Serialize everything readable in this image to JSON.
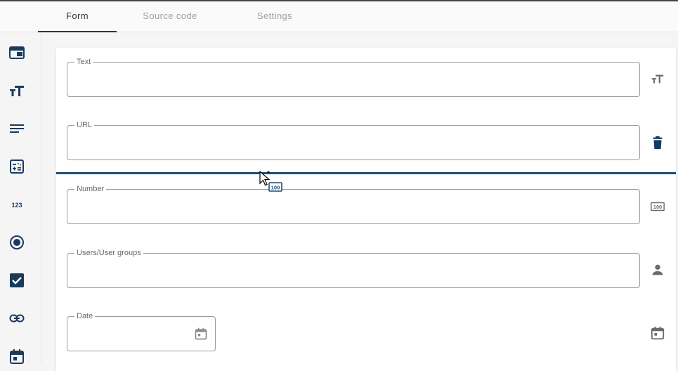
{
  "tabs": [
    {
      "label": "Form",
      "active": true
    },
    {
      "label": "Source code",
      "active": false
    },
    {
      "label": "Settings",
      "active": false
    }
  ],
  "sidebar": {
    "items": [
      {
        "icon": "form-layout-icon"
      },
      {
        "icon": "text-size-icon"
      },
      {
        "icon": "paragraph-icon"
      },
      {
        "icon": "calculator-icon"
      },
      {
        "icon": "number-123-icon"
      },
      {
        "icon": "radio-button-icon"
      },
      {
        "icon": "checkbox-icon"
      },
      {
        "icon": "link-icon"
      },
      {
        "icon": "calendar-icon"
      }
    ]
  },
  "fields": [
    {
      "label": "Text",
      "value": "",
      "icon": "text-size-icon"
    },
    {
      "label": "URL",
      "value": "",
      "icon": "trash-icon"
    },
    {
      "label": "Number",
      "value": "",
      "icon": "number-field-icon"
    },
    {
      "label": "Users/User groups",
      "value": "",
      "icon": "person-icon"
    },
    {
      "label": "Date",
      "value": "",
      "icon": "calendar-icon"
    }
  ],
  "colors": {
    "accent": "#1a3a5c",
    "drop_indicator": "#1c4f76",
    "icon_dark": "#1a3a5c",
    "icon_gray": "#6b6b6b"
  }
}
